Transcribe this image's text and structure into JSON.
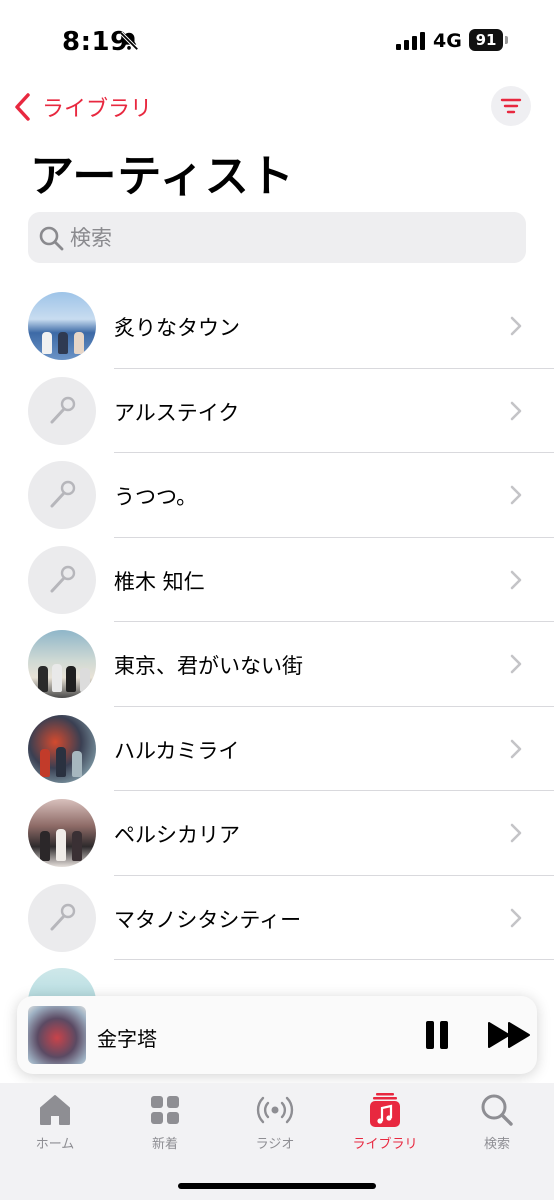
{
  "status_bar": {
    "time": "8:19",
    "network": "4G",
    "battery": "91"
  },
  "nav": {
    "back_label": "ライブラリ"
  },
  "page": {
    "title": "アーティスト"
  },
  "search": {
    "placeholder": "検索"
  },
  "artists": [
    {
      "name": "炙りなタウン",
      "avatar": "photo"
    },
    {
      "name": "アルステイク",
      "avatar": "mic-icon"
    },
    {
      "name": "うつつ。",
      "avatar": "mic-icon"
    },
    {
      "name": "椎木 知仁",
      "avatar": "mic-icon"
    },
    {
      "name": "東京、君がいない街",
      "avatar": "photo"
    },
    {
      "name": "ハルカミライ",
      "avatar": "photo"
    },
    {
      "name": "ペルシカリア",
      "avatar": "photo"
    },
    {
      "name": "マタノシタシティー",
      "avatar": "mic-icon"
    }
  ],
  "now_playing": {
    "title": "金字塔"
  },
  "tabs": [
    {
      "label": "ホーム",
      "icon": "home-icon",
      "active": false
    },
    {
      "label": "新着",
      "icon": "grid-icon",
      "active": false
    },
    {
      "label": "ラジオ",
      "icon": "radio-icon",
      "active": false
    },
    {
      "label": "ライブラリ",
      "icon": "library-icon",
      "active": true
    },
    {
      "label": "検索",
      "icon": "search-icon",
      "active": false
    }
  ],
  "colors": {
    "accent": "#e8283f",
    "inactive": "#8e8e93"
  }
}
